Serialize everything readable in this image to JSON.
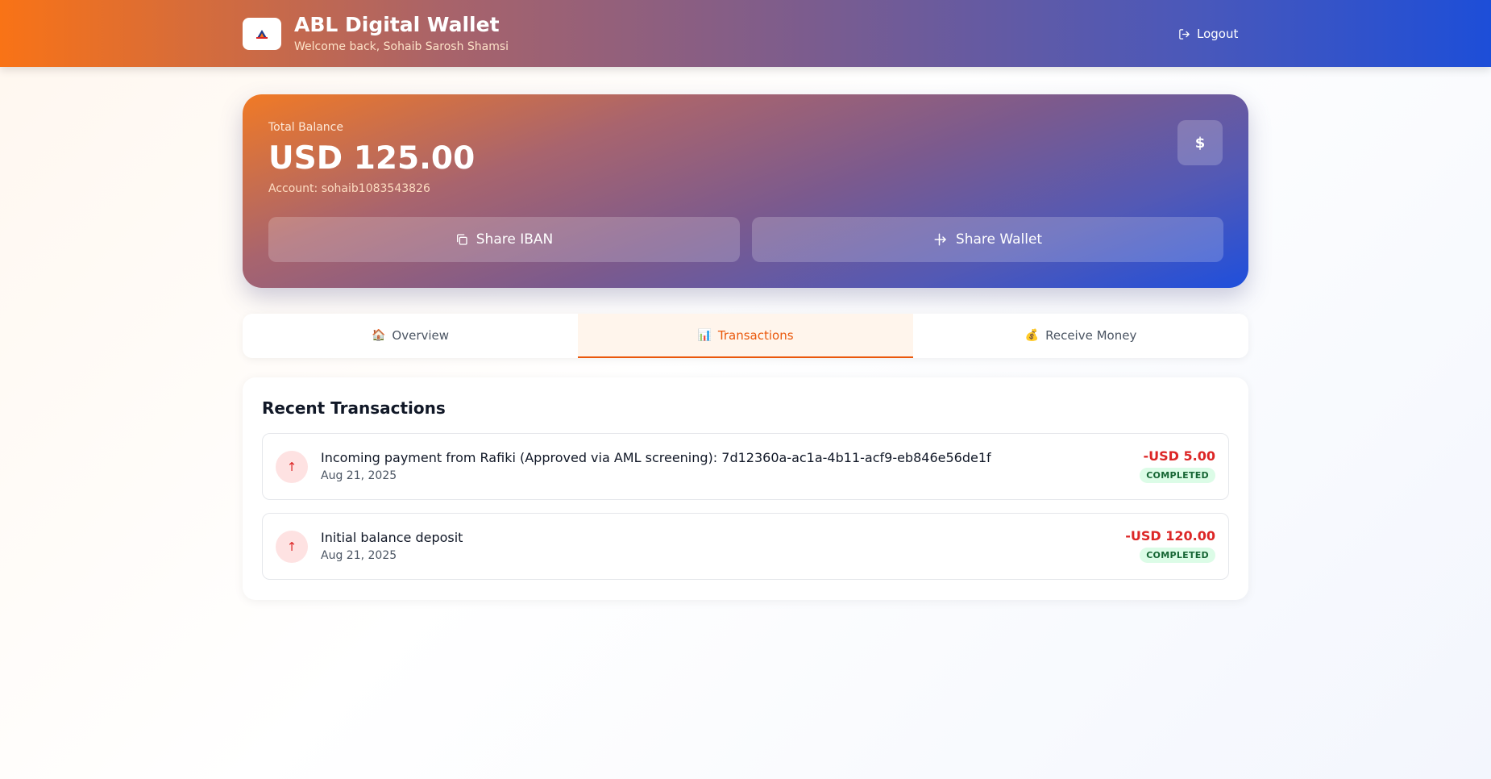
{
  "header": {
    "app_title": "ABL Digital Wallet",
    "welcome": "Welcome back, Sohaib Sarosh Shamsi",
    "logout_label": "Logout"
  },
  "balance": {
    "label": "Total Balance",
    "amount": "USD 125.00",
    "account": "Account: sohaib1083543826",
    "currency_symbol": "$",
    "share_iban_label": "Share IBAN",
    "share_wallet_label": "Share Wallet"
  },
  "tabs": [
    {
      "icon": "🏠",
      "label": "Overview",
      "active": false
    },
    {
      "icon": "📊",
      "label": "Transactions",
      "active": true
    },
    {
      "icon": "💰",
      "label": "Receive Money",
      "active": false
    }
  ],
  "transactions": {
    "heading": "Recent Transactions",
    "items": [
      {
        "icon": "↑",
        "description": "Incoming payment from Rafiki (Approved via AML screening): 7d12360a-ac1a-4b11-acf9-eb846e56de1f",
        "date": "Aug 21, 2025",
        "amount": "-USD 5.00",
        "status": "COMPLETED"
      },
      {
        "icon": "↑",
        "description": "Initial balance deposit",
        "date": "Aug 21, 2025",
        "amount": "-USD 120.00",
        "status": "COMPLETED"
      }
    ]
  },
  "colors": {
    "brand_orange": "#f97316",
    "brand_blue": "#1d4ed8",
    "negative_amount": "#dc2626",
    "status_completed_bg": "#dcfce7",
    "status_completed_text": "#166534"
  },
  "icons": {
    "logo": "abl-logo-icon",
    "logout": "logout-icon",
    "copy": "copy-icon",
    "share": "share-icon"
  }
}
